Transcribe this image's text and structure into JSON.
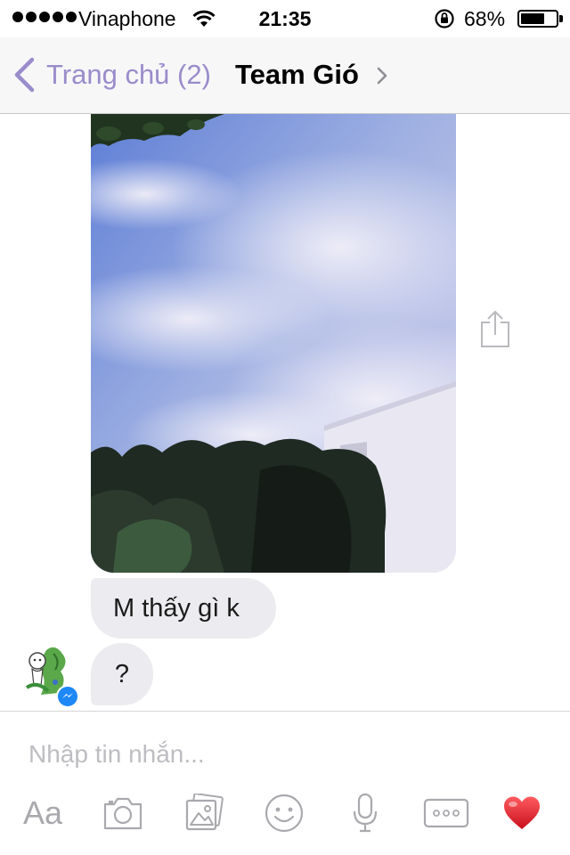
{
  "status_bar": {
    "carrier": "Vinaphone",
    "time": "21:35",
    "battery_percent": "68%",
    "battery_level": 0.68,
    "signal_bars": 5
  },
  "nav": {
    "back_label": "Trang chủ (2)",
    "title": "Team Gió"
  },
  "messages": [
    {
      "type": "photo",
      "description_icon": "photo-message"
    },
    {
      "type": "text",
      "text": "M thấy gì k"
    },
    {
      "type": "text",
      "text": "?"
    }
  ],
  "composer": {
    "placeholder": "Nhập tin nhắn...",
    "text_format_label": "Aa",
    "icons": [
      "camera-icon",
      "gallery-icon",
      "emoji-icon",
      "microphone-icon",
      "more-icon",
      "heart-icon"
    ]
  },
  "colors": {
    "accent": "#9a8ccb",
    "bubble": "#ececf0",
    "heart": "#e0202c",
    "messenger_badge": "#1e88f6"
  }
}
